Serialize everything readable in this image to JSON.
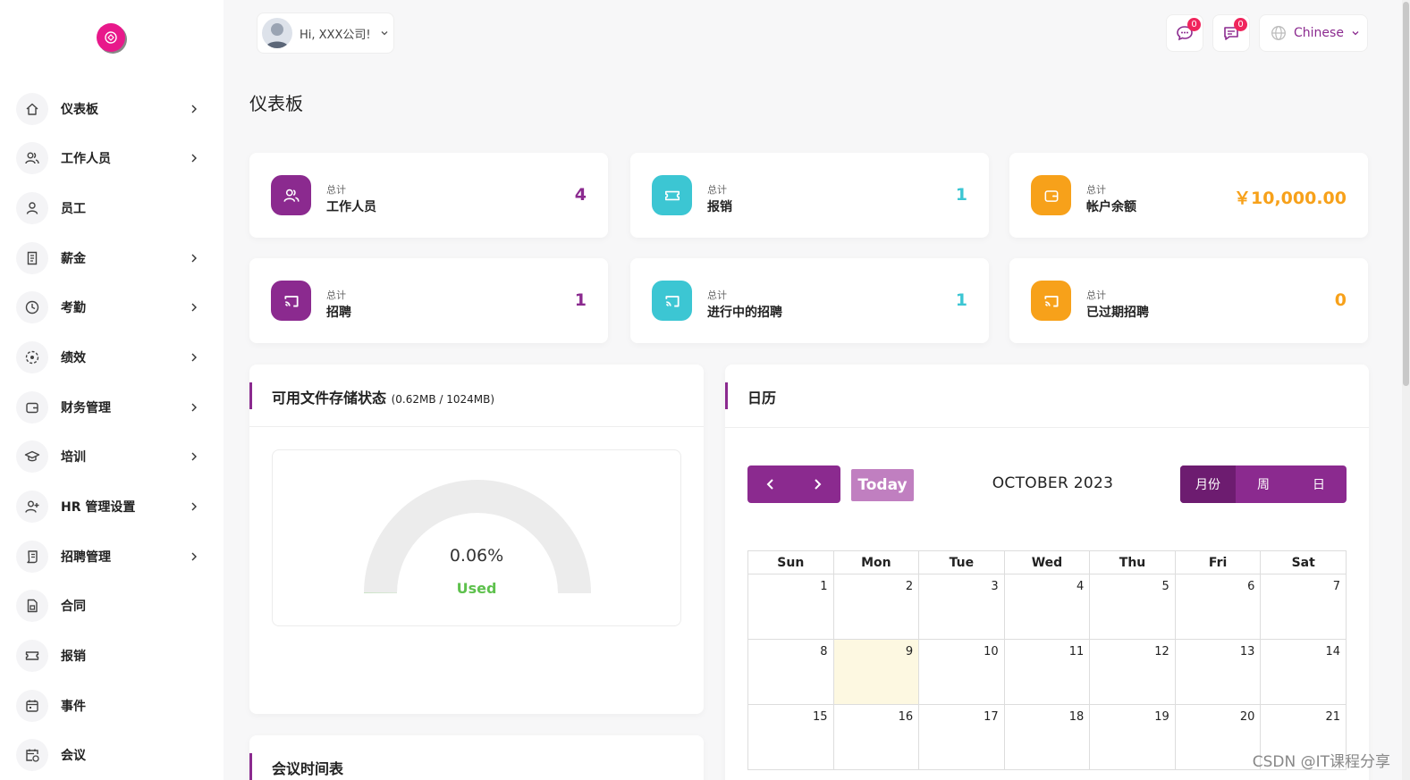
{
  "user": {
    "greeting": "Hi, XXX公司!"
  },
  "topbar": {
    "chat_badge": "0",
    "message_badge": "0",
    "language": "Chinese"
  },
  "sidebar": {
    "items": [
      {
        "label": "仪表板",
        "icon": "home-icon",
        "chevron": true
      },
      {
        "label": "工作人员",
        "icon": "users-icon",
        "chevron": true
      },
      {
        "label": "员工",
        "icon": "user-icon",
        "chevron": false
      },
      {
        "label": "薪金",
        "icon": "receipt-icon",
        "chevron": true
      },
      {
        "label": "考勤",
        "icon": "clock-icon",
        "chevron": true
      },
      {
        "label": "绩效",
        "icon": "target-icon",
        "chevron": true
      },
      {
        "label": "财务管理",
        "icon": "wallet-icon",
        "chevron": true
      },
      {
        "label": "培训",
        "icon": "graduation-cap-icon",
        "chevron": true
      },
      {
        "label": "HR 管理设置",
        "icon": "user-plus-icon",
        "chevron": true
      },
      {
        "label": "招聘管理",
        "icon": "scroll-icon",
        "chevron": true
      },
      {
        "label": "合同",
        "icon": "file-icon",
        "chevron": false
      },
      {
        "label": "报销",
        "icon": "ticket-icon",
        "chevron": false
      },
      {
        "label": "事件",
        "icon": "calendar-icon",
        "chevron": false
      },
      {
        "label": "会议",
        "icon": "calendar-clock-icon",
        "chevron": false
      }
    ]
  },
  "page": {
    "title": "仪表板"
  },
  "stats": [
    {
      "caption": "总计",
      "label": "工作人员",
      "value": "4",
      "color": "#8b2a8f",
      "icon": "users-icon"
    },
    {
      "caption": "总计",
      "label": "报销",
      "value": "1",
      "color": "#3cc6d3",
      "icon": "ticket-icon"
    },
    {
      "caption": "总计",
      "label": "帐户余额",
      "value": "￥10,000.00",
      "color": "#f7a11a",
      "icon": "wallet-icon"
    },
    {
      "caption": "总计",
      "label": "招聘",
      "value": "1",
      "color": "#8b2a8f",
      "icon": "cast-icon"
    },
    {
      "caption": "总计",
      "label": "进行中的招聘",
      "value": "1",
      "color": "#3cc6d3",
      "icon": "cast-icon"
    },
    {
      "caption": "总计",
      "label": "已过期招聘",
      "value": "0",
      "color": "#f7a11a",
      "icon": "cast-icon"
    }
  ],
  "storage": {
    "title": "可用文件存储状态",
    "subtitle": "(0.62MB / 1024MB)",
    "percent_label": "0.06%",
    "used_label": "Used",
    "used_fraction": 0.0006
  },
  "meetings": {
    "title": "会议时间表"
  },
  "calendar": {
    "title": "日历",
    "today_label": "Today",
    "month_label": "OCTOBER 2023",
    "views": [
      "月份",
      "周",
      "日"
    ],
    "active_view": 0,
    "weekdays": [
      "Sun",
      "Mon",
      "Tue",
      "Wed",
      "Thu",
      "Fri",
      "Sat"
    ],
    "weeks": [
      [
        "1",
        "2",
        "3",
        "4",
        "5",
        "6",
        "7"
      ],
      [
        "8",
        "9",
        "10",
        "11",
        "12",
        "13",
        "14"
      ],
      [
        "15",
        "16",
        "17",
        "18",
        "19",
        "20",
        "21"
      ]
    ],
    "today": "9"
  },
  "watermark": "CSDN @IT课程分享",
  "colors": {
    "primary": "#8b2a8f",
    "cyan": "#3cc6d3",
    "orange": "#f7a11a",
    "badge": "#f0255c",
    "today_bg": "#fdf8e1"
  }
}
